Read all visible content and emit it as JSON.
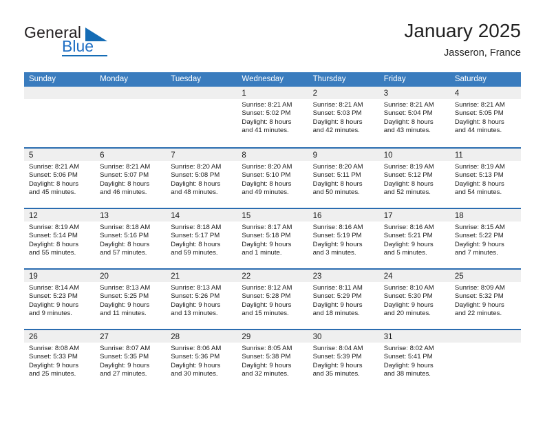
{
  "brand": {
    "name_part1": "General",
    "name_part2": "Blue",
    "triangle_icon": "brand-triangle-icon",
    "colors": {
      "blue": "#156cb5",
      "dark": "#231f20"
    }
  },
  "header": {
    "title": "January 2025",
    "subtitle": "Jasseron, France"
  },
  "calendar": {
    "header_color": "#3a7cbe",
    "row_divider_color": "#2a6cb0",
    "day_band_color": "#efefef",
    "weekdays": [
      "Sunday",
      "Monday",
      "Tuesday",
      "Wednesday",
      "Thursday",
      "Friday",
      "Saturday"
    ],
    "weeks": [
      [
        {
          "day": "",
          "empty": true
        },
        {
          "day": "",
          "empty": true
        },
        {
          "day": "",
          "empty": true
        },
        {
          "day": "1",
          "sunrise": "Sunrise: 8:21 AM",
          "sunset": "Sunset: 5:02 PM",
          "daylight_line1": "Daylight: 8 hours",
          "daylight_line2": "and 41 minutes."
        },
        {
          "day": "2",
          "sunrise": "Sunrise: 8:21 AM",
          "sunset": "Sunset: 5:03 PM",
          "daylight_line1": "Daylight: 8 hours",
          "daylight_line2": "and 42 minutes."
        },
        {
          "day": "3",
          "sunrise": "Sunrise: 8:21 AM",
          "sunset": "Sunset: 5:04 PM",
          "daylight_line1": "Daylight: 8 hours",
          "daylight_line2": "and 43 minutes."
        },
        {
          "day": "4",
          "sunrise": "Sunrise: 8:21 AM",
          "sunset": "Sunset: 5:05 PM",
          "daylight_line1": "Daylight: 8 hours",
          "daylight_line2": "and 44 minutes."
        }
      ],
      [
        {
          "day": "5",
          "sunrise": "Sunrise: 8:21 AM",
          "sunset": "Sunset: 5:06 PM",
          "daylight_line1": "Daylight: 8 hours",
          "daylight_line2": "and 45 minutes."
        },
        {
          "day": "6",
          "sunrise": "Sunrise: 8:21 AM",
          "sunset": "Sunset: 5:07 PM",
          "daylight_line1": "Daylight: 8 hours",
          "daylight_line2": "and 46 minutes."
        },
        {
          "day": "7",
          "sunrise": "Sunrise: 8:20 AM",
          "sunset": "Sunset: 5:08 PM",
          "daylight_line1": "Daylight: 8 hours",
          "daylight_line2": "and 48 minutes."
        },
        {
          "day": "8",
          "sunrise": "Sunrise: 8:20 AM",
          "sunset": "Sunset: 5:10 PM",
          "daylight_line1": "Daylight: 8 hours",
          "daylight_line2": "and 49 minutes."
        },
        {
          "day": "9",
          "sunrise": "Sunrise: 8:20 AM",
          "sunset": "Sunset: 5:11 PM",
          "daylight_line1": "Daylight: 8 hours",
          "daylight_line2": "and 50 minutes."
        },
        {
          "day": "10",
          "sunrise": "Sunrise: 8:19 AM",
          "sunset": "Sunset: 5:12 PM",
          "daylight_line1": "Daylight: 8 hours",
          "daylight_line2": "and 52 minutes."
        },
        {
          "day": "11",
          "sunrise": "Sunrise: 8:19 AM",
          "sunset": "Sunset: 5:13 PM",
          "daylight_line1": "Daylight: 8 hours",
          "daylight_line2": "and 54 minutes."
        }
      ],
      [
        {
          "day": "12",
          "sunrise": "Sunrise: 8:19 AM",
          "sunset": "Sunset: 5:14 PM",
          "daylight_line1": "Daylight: 8 hours",
          "daylight_line2": "and 55 minutes."
        },
        {
          "day": "13",
          "sunrise": "Sunrise: 8:18 AM",
          "sunset": "Sunset: 5:16 PM",
          "daylight_line1": "Daylight: 8 hours",
          "daylight_line2": "and 57 minutes."
        },
        {
          "day": "14",
          "sunrise": "Sunrise: 8:18 AM",
          "sunset": "Sunset: 5:17 PM",
          "daylight_line1": "Daylight: 8 hours",
          "daylight_line2": "and 59 minutes."
        },
        {
          "day": "15",
          "sunrise": "Sunrise: 8:17 AM",
          "sunset": "Sunset: 5:18 PM",
          "daylight_line1": "Daylight: 9 hours",
          "daylight_line2": "and 1 minute."
        },
        {
          "day": "16",
          "sunrise": "Sunrise: 8:16 AM",
          "sunset": "Sunset: 5:19 PM",
          "daylight_line1": "Daylight: 9 hours",
          "daylight_line2": "and 3 minutes."
        },
        {
          "day": "17",
          "sunrise": "Sunrise: 8:16 AM",
          "sunset": "Sunset: 5:21 PM",
          "daylight_line1": "Daylight: 9 hours",
          "daylight_line2": "and 5 minutes."
        },
        {
          "day": "18",
          "sunrise": "Sunrise: 8:15 AM",
          "sunset": "Sunset: 5:22 PM",
          "daylight_line1": "Daylight: 9 hours",
          "daylight_line2": "and 7 minutes."
        }
      ],
      [
        {
          "day": "19",
          "sunrise": "Sunrise: 8:14 AM",
          "sunset": "Sunset: 5:23 PM",
          "daylight_line1": "Daylight: 9 hours",
          "daylight_line2": "and 9 minutes."
        },
        {
          "day": "20",
          "sunrise": "Sunrise: 8:13 AM",
          "sunset": "Sunset: 5:25 PM",
          "daylight_line1": "Daylight: 9 hours",
          "daylight_line2": "and 11 minutes."
        },
        {
          "day": "21",
          "sunrise": "Sunrise: 8:13 AM",
          "sunset": "Sunset: 5:26 PM",
          "daylight_line1": "Daylight: 9 hours",
          "daylight_line2": "and 13 minutes."
        },
        {
          "day": "22",
          "sunrise": "Sunrise: 8:12 AM",
          "sunset": "Sunset: 5:28 PM",
          "daylight_line1": "Daylight: 9 hours",
          "daylight_line2": "and 15 minutes."
        },
        {
          "day": "23",
          "sunrise": "Sunrise: 8:11 AM",
          "sunset": "Sunset: 5:29 PM",
          "daylight_line1": "Daylight: 9 hours",
          "daylight_line2": "and 18 minutes."
        },
        {
          "day": "24",
          "sunrise": "Sunrise: 8:10 AM",
          "sunset": "Sunset: 5:30 PM",
          "daylight_line1": "Daylight: 9 hours",
          "daylight_line2": "and 20 minutes."
        },
        {
          "day": "25",
          "sunrise": "Sunrise: 8:09 AM",
          "sunset": "Sunset: 5:32 PM",
          "daylight_line1": "Daylight: 9 hours",
          "daylight_line2": "and 22 minutes."
        }
      ],
      [
        {
          "day": "26",
          "sunrise": "Sunrise: 8:08 AM",
          "sunset": "Sunset: 5:33 PM",
          "daylight_line1": "Daylight: 9 hours",
          "daylight_line2": "and 25 minutes."
        },
        {
          "day": "27",
          "sunrise": "Sunrise: 8:07 AM",
          "sunset": "Sunset: 5:35 PM",
          "daylight_line1": "Daylight: 9 hours",
          "daylight_line2": "and 27 minutes."
        },
        {
          "day": "28",
          "sunrise": "Sunrise: 8:06 AM",
          "sunset": "Sunset: 5:36 PM",
          "daylight_line1": "Daylight: 9 hours",
          "daylight_line2": "and 30 minutes."
        },
        {
          "day": "29",
          "sunrise": "Sunrise: 8:05 AM",
          "sunset": "Sunset: 5:38 PM",
          "daylight_line1": "Daylight: 9 hours",
          "daylight_line2": "and 32 minutes."
        },
        {
          "day": "30",
          "sunrise": "Sunrise: 8:04 AM",
          "sunset": "Sunset: 5:39 PM",
          "daylight_line1": "Daylight: 9 hours",
          "daylight_line2": "and 35 minutes."
        },
        {
          "day": "31",
          "sunrise": "Sunrise: 8:02 AM",
          "sunset": "Sunset: 5:41 PM",
          "daylight_line1": "Daylight: 9 hours",
          "daylight_line2": "and 38 minutes."
        },
        {
          "day": "",
          "empty": true
        }
      ]
    ]
  }
}
